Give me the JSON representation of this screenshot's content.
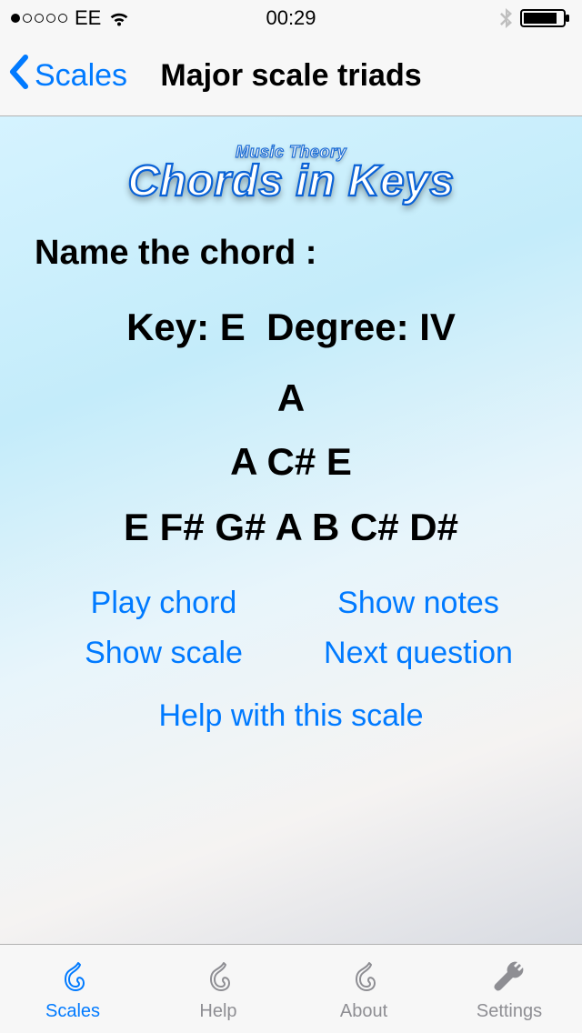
{
  "status": {
    "carrier": "EE",
    "time": "00:29"
  },
  "nav": {
    "back_label": "Scales",
    "title": "Major scale triads"
  },
  "logo": {
    "sub": "Music Theory",
    "main": "Chords in Keys"
  },
  "quiz": {
    "prompt": "Name the chord :",
    "key_label": "Key:",
    "key": "E",
    "degree_label": "Degree:",
    "degree": "IV",
    "answer_chord": "A",
    "chord_notes": "A C# E",
    "scale_notes": "E F# G# A B C# D#"
  },
  "buttons": {
    "play_chord": "Play chord",
    "show_notes": "Show notes",
    "show_scale": "Show scale",
    "next_question": "Next question",
    "help_scale": "Help with this scale"
  },
  "tabs": {
    "scales": "Scales",
    "help": "Help",
    "about": "About",
    "settings": "Settings"
  }
}
